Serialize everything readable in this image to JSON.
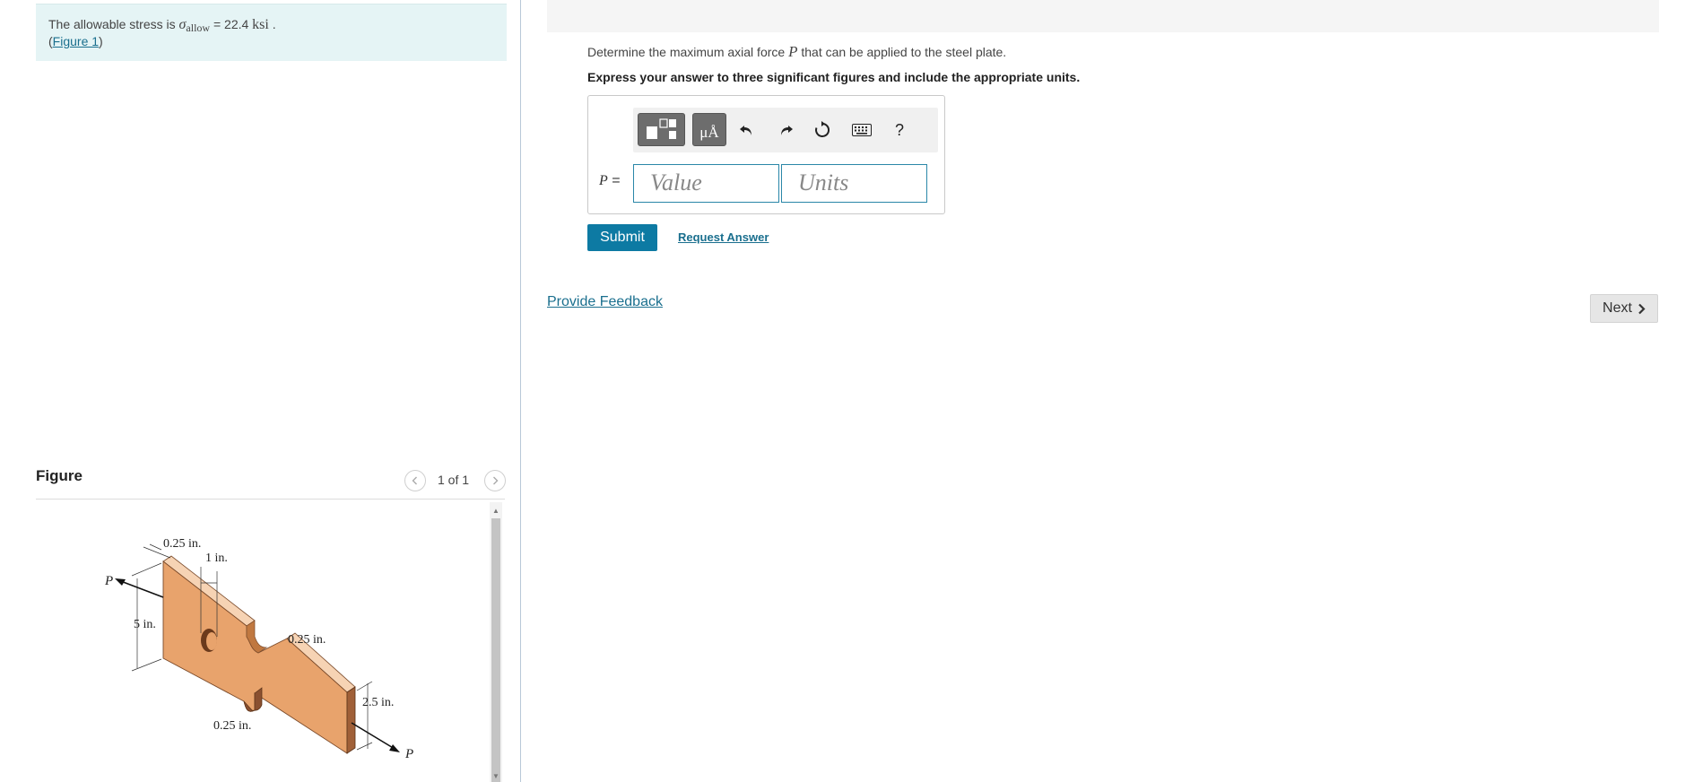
{
  "problem": {
    "text_prefix": "The allowable stress is ",
    "sigma": "σ",
    "sub": "allow",
    "equals_value": " = 22.4 ",
    "unit": "ksi",
    "end_dot": " .",
    "open_paren": "(",
    "figure_link": "Figure 1",
    "close_paren": ")"
  },
  "figure": {
    "title": "Figure",
    "pager": "1 of 1",
    "labels": {
      "top_thickness": "0.25 in.",
      "one_in": "1 in.",
      "p_left": "P",
      "five_in": "5 in.",
      "hole_thickness": "0.25 in.",
      "two_five": "2.5 in.",
      "bottom_thickness": "0.25 in.",
      "p_right": "P"
    }
  },
  "part": {
    "question": "Determine the maximum axial force P that can be applied to the steel plate.",
    "question_pre": "Determine the maximum axial force ",
    "question_var": "P",
    "question_post": " that can be applied to the steel plate.",
    "instructions": "Express your answer to three significant figures and include the appropriate units.",
    "answer_label_var": "P",
    "answer_label_eq": " =",
    "value_placeholder": "Value",
    "units_placeholder": "Units",
    "units_button": "μÅ",
    "help": "?",
    "submit": "Submit",
    "request_answer": "Request Answer"
  },
  "footer": {
    "feedback": "Provide Feedback",
    "next": "Next"
  },
  "colors": {
    "plate_face": "#e8a36c",
    "plate_top": "#f6d3b4",
    "plate_edge": "#a06038",
    "accent": "#0d7aa3",
    "problem_bg": "#e5f4f5"
  }
}
